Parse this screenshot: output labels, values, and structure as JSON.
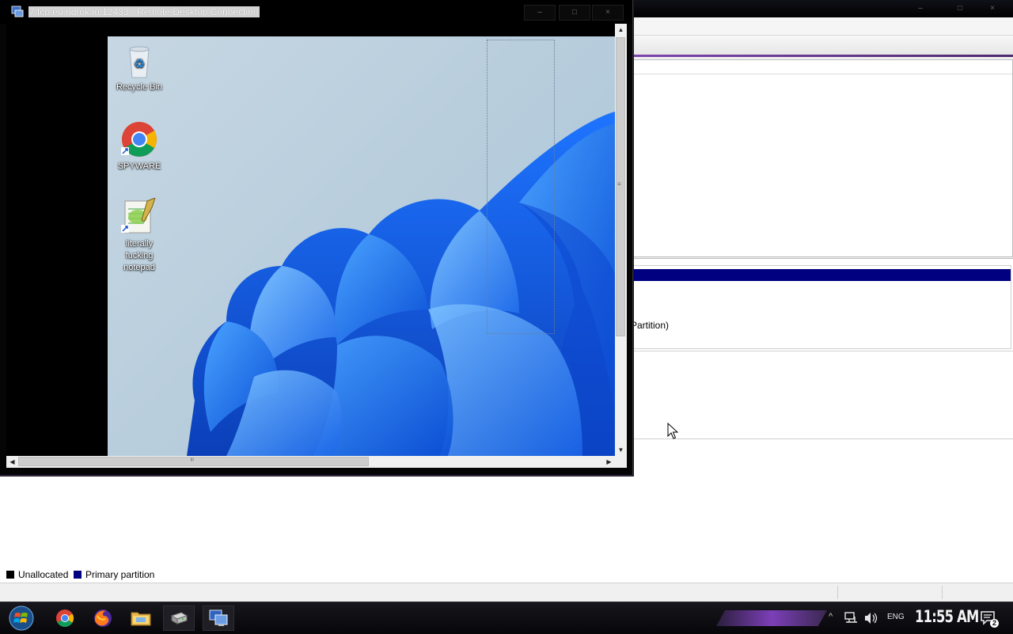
{
  "rdp_window": {
    "title": "7.tcp.eu.ngrok.io:12433 - Remote Desktop Connection",
    "minimize_label": "–",
    "maximize_label": "□",
    "close_label": "×"
  },
  "remote_desktop": {
    "icons": [
      {
        "label": "Recycle Bin",
        "icon": "recycle-bin-icon"
      },
      {
        "label": "SPYWARE",
        "icon": "chrome-icon"
      },
      {
        "label": "literally fucking notepad",
        "icon": "notepad-plus-icon"
      }
    ]
  },
  "scrollbars": {
    "up": "▲",
    "down": "▼",
    "left": "◀",
    "right": "▶",
    "grip": "≡"
  },
  "disk_management": {
    "partition_text": "Partition)",
    "legend": [
      {
        "label": "Unallocated",
        "color": "#000000"
      },
      {
        "label": "Primary partition",
        "color": "#000080"
      }
    ]
  },
  "taskbar": {
    "items": [
      {
        "name": "start-button",
        "icon": "windows-orb-icon"
      },
      {
        "name": "chrome",
        "icon": "chrome-icon"
      },
      {
        "name": "firefox",
        "icon": "firefox-icon"
      },
      {
        "name": "file-explorer",
        "icon": "folder-icon"
      },
      {
        "name": "disk-management",
        "icon": "disk-management-icon"
      },
      {
        "name": "remote-desktop",
        "icon": "remote-desktop-icon"
      }
    ],
    "tray": {
      "overflow": "^",
      "language": "ENG",
      "clock": "11:55 AM",
      "notification_count": "2"
    }
  },
  "colors": {
    "accent_purple": "#7c3fb8",
    "primary_partition": "#000080"
  }
}
